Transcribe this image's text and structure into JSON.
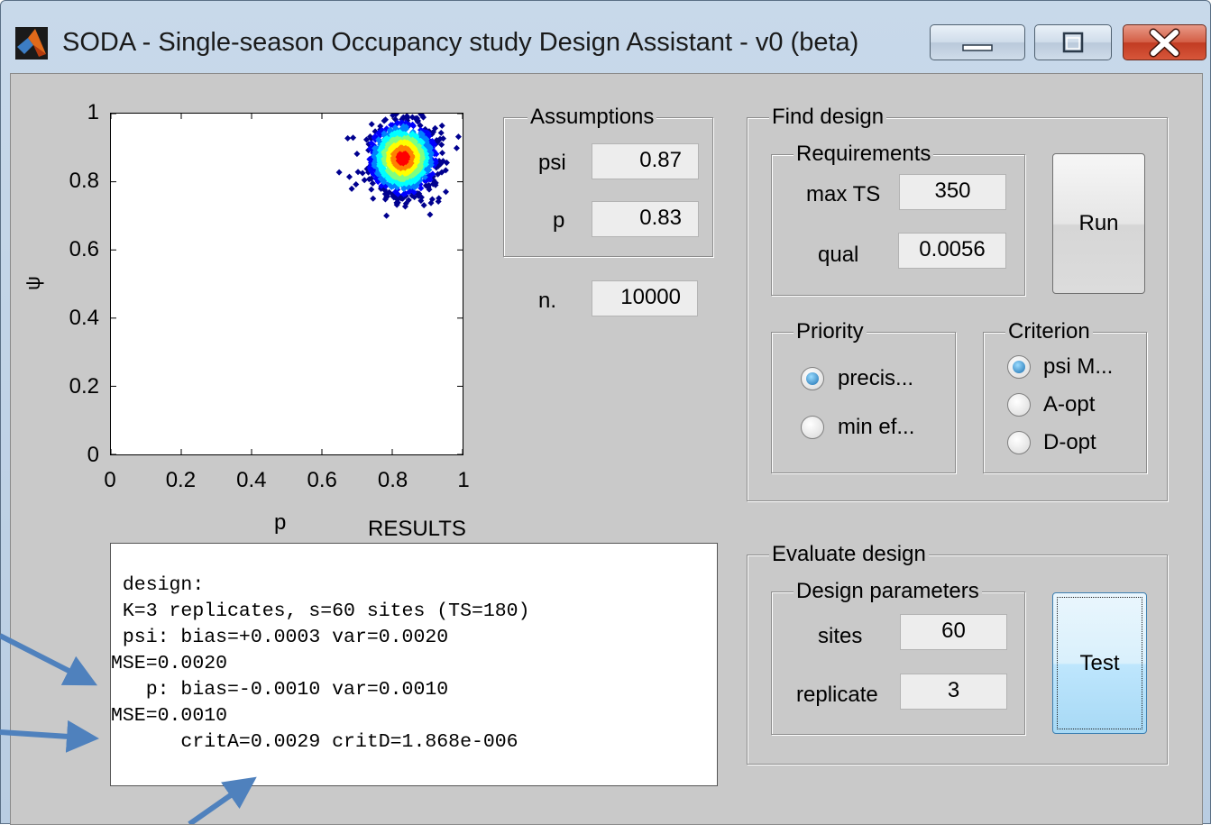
{
  "window": {
    "title": "SODA - Single-season Occupancy study Design Assistant - v0 (beta)",
    "controls": {
      "minimize": "minimize-icon",
      "maximize": "maximize-icon",
      "close": "close-icon"
    }
  },
  "chart_data": {
    "type": "scatter",
    "xlabel": "p",
    "ylabel": "ψ",
    "xlim": [
      0,
      1
    ],
    "ylim": [
      0,
      1
    ],
    "x_ticks": [
      "0",
      "0.2",
      "0.4",
      "0.6",
      "0.8",
      "1"
    ],
    "y_ticks": [
      "0",
      "0.2",
      "0.4",
      "0.6",
      "0.8",
      "1"
    ],
    "cluster_center": {
      "x": 0.83,
      "y": 0.87
    },
    "cluster_spread": {
      "x": 0.045,
      "y": 0.05
    },
    "colormap": [
      "#00008f",
      "#0000ff",
      "#0080ff",
      "#00ffff",
      "#80ff80",
      "#ffff00",
      "#ff8000",
      "#ff0000",
      "#800000"
    ],
    "grid": false
  },
  "results": {
    "title": "RESULTS",
    "lines": [
      " design:",
      " K=3 replicates, s=60 sites (TS=180)",
      " psi: bias=+0.0003 var=0.0020",
      "MSE=0.0020",
      "   p: bias=-0.0010 var=0.0010",
      "MSE=0.0010",
      "      critA=0.0029 critD=1.868e-006"
    ]
  },
  "assumptions": {
    "title": "Assumptions",
    "psi_label": "psi",
    "psi_value": "0.87",
    "p_label": "p",
    "p_value": "0.83"
  },
  "n": {
    "label": "n.",
    "value": "10000"
  },
  "find_design": {
    "title": "Find design",
    "requirements": {
      "title": "Requirements",
      "max_ts_label": "max TS",
      "max_ts_value": "350",
      "qual_label": "qual",
      "qual_value": "0.0056"
    },
    "run_label": "Run",
    "priority": {
      "title": "Priority",
      "options": [
        "precis...",
        "min ef..."
      ],
      "selected": "precis..."
    },
    "criterion": {
      "title": "Criterion",
      "options": [
        "psi M...",
        "A-opt",
        "D-opt"
      ],
      "selected": "psi M..."
    }
  },
  "evaluate_design": {
    "title": "Evaluate design",
    "parameters": {
      "title": "Design parameters",
      "sites_label": "sites",
      "sites_value": "60",
      "replicate_label": "replicate",
      "replicate_value": "3"
    },
    "test_label": "Test"
  },
  "annotations": {
    "arrow_color": "#4f81bd"
  }
}
